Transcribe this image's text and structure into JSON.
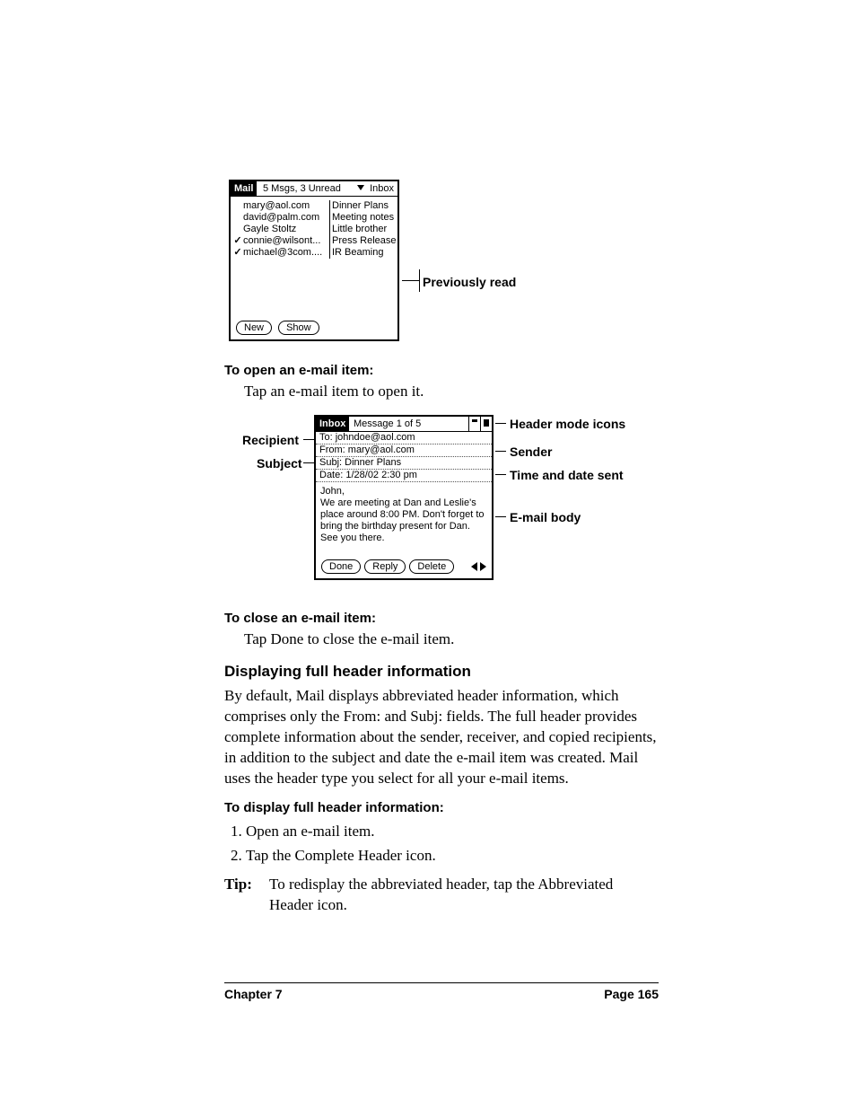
{
  "fig1": {
    "app": "Mail",
    "status": "5 Msgs, 3 Unread",
    "folder": "Inbox",
    "rows": [
      {
        "check": "",
        "sender": "mary@aol.com",
        "subject": "Dinner Plans"
      },
      {
        "check": "",
        "sender": "david@palm.com",
        "subject": "Meeting notes"
      },
      {
        "check": "",
        "sender": "Gayle Stoltz",
        "subject": "Little brother"
      },
      {
        "check": "✓",
        "sender": "connie@wilsont...",
        "subject": "Press Release"
      },
      {
        "check": "✓",
        "sender": "michael@3com....",
        "subject": "IR Beaming"
      }
    ],
    "buttons": {
      "new": "New",
      "show": "Show"
    },
    "callout": "Previously read"
  },
  "open": {
    "heading": "To open an e-mail item:",
    "text": "Tap an e-mail item to open it."
  },
  "fig2": {
    "app": "Inbox",
    "count": "Message 1 of 5",
    "fields": {
      "to": "To:  johndoe@aol.com",
      "from": "From:  mary@aol.com",
      "subj": "Subj:  Dinner Plans",
      "date": "Date:  1/28/02 2:30 pm"
    },
    "body": "John,\nWe are meeting at Dan and Leslie's place around 8:00 PM.  Don't forget to bring the birthday present for Dan.  See you there.",
    "buttons": {
      "done": "Done",
      "reply": "Reply",
      "delete": "Delete"
    },
    "left": {
      "recipient": "Recipient",
      "subject": "Subject"
    },
    "right": {
      "icons": "Header mode icons",
      "sender": "Sender",
      "time": "Time and date sent",
      "body": "E-mail body"
    }
  },
  "close": {
    "heading": "To close an e-mail item:",
    "text": "Tap Done to close the e-mail item."
  },
  "section": {
    "heading": "Displaying full header information",
    "para": "By default, Mail displays abbreviated header information, which comprises only the From: and Subj: fields. The full header provides complete information about the sender, receiver, and copied recipients, in addition to the subject and date the e-mail item was created. Mail uses the header type you select for all your e-mail items.",
    "subheading": "To display full header information:",
    "steps": [
      "Open an e-mail item.",
      "Tap the Complete Header icon."
    ],
    "tip_label": "Tip:",
    "tip_text": "To redisplay the abbreviated header, tap the Abbreviated Header icon."
  },
  "footer": {
    "left": "Chapter 7",
    "right": "Page 165"
  }
}
